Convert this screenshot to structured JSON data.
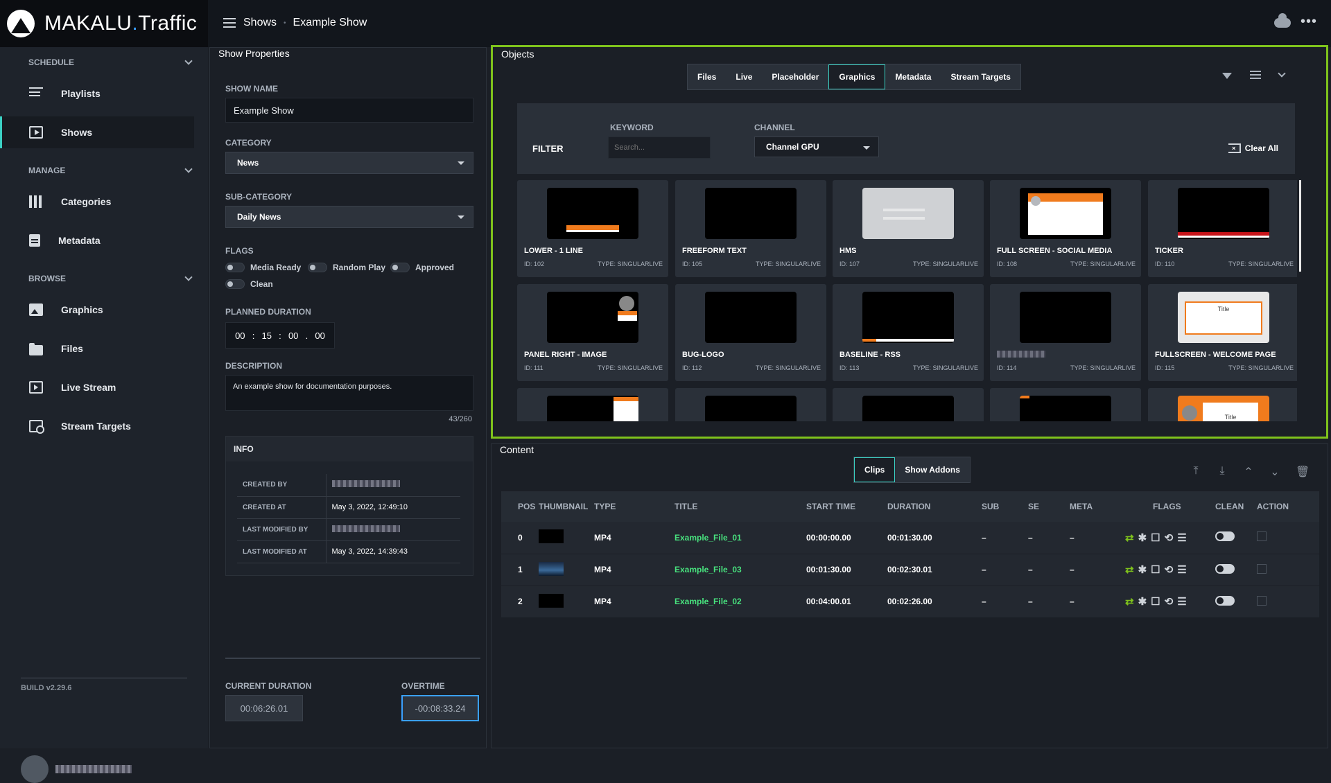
{
  "app": {
    "brand_main": "MAKALU",
    "brand_dot": ".",
    "brand_sub": "Traffic"
  },
  "breadcrumb": {
    "root": "Shows",
    "sep": "•",
    "current": "Example Show"
  },
  "sidebar": {
    "sections": [
      {
        "label": "SCHEDULE",
        "items": [
          {
            "label": "Playlists",
            "icon": "playlist-icon"
          },
          {
            "label": "Shows",
            "icon": "play-icon",
            "active": true
          }
        ]
      },
      {
        "label": "MANAGE",
        "items": [
          {
            "label": "Categories",
            "icon": "categories-icon"
          },
          {
            "label": "Metadata",
            "icon": "document-icon"
          }
        ]
      },
      {
        "label": "BROWSE",
        "items": [
          {
            "label": "Graphics",
            "icon": "image-icon"
          },
          {
            "label": "Files",
            "icon": "folder-icon"
          },
          {
            "label": "Live Stream",
            "icon": "live-icon"
          },
          {
            "label": "Stream Targets",
            "icon": "target-icon"
          }
        ]
      }
    ],
    "build": "BUILD v2.29.6"
  },
  "props": {
    "title": "Show Properties",
    "show_name_label": "SHOW NAME",
    "show_name": "Example Show",
    "category_label": "CATEGORY",
    "category": "News",
    "subcategory_label": "SUB-CATEGORY",
    "subcategory": "Daily News",
    "flags_label": "FLAGS",
    "flags": [
      "Media Ready",
      "Random Play",
      "Approved",
      "Clean"
    ],
    "planned_label": "PLANNED DURATION",
    "planned": [
      "00",
      "15",
      "00",
      "00"
    ],
    "description_label": "DESCRIPTION",
    "description": "An example show for documentation purposes.",
    "char_count": "43/260",
    "info_title": "INFO",
    "info": [
      {
        "key": "CREATED BY",
        "value": ""
      },
      {
        "key": "CREATED AT",
        "value": "May 3, 2022, 12:49:10"
      },
      {
        "key": "LAST MODIFIED BY",
        "value": ""
      },
      {
        "key": "LAST MODIFIED AT",
        "value": "May 3, 2022, 14:39:43"
      }
    ],
    "current_label": "CURRENT DURATION",
    "current": "00:06:26.01",
    "overtime_label": "OVERTIME",
    "overtime": "-00:08:33.24"
  },
  "objects": {
    "title": "Objects",
    "tabs": [
      "Files",
      "Live",
      "Placeholder",
      "Graphics",
      "Metadata",
      "Stream Targets"
    ],
    "active_tab": "Graphics",
    "filter_label": "FILTER",
    "keyword_label": "KEYWORD",
    "keyword_placeholder": "Search...",
    "channel_label": "CHANNEL",
    "channel": "Channel GPU",
    "clear_all": "Clear All",
    "cards": [
      {
        "name": "LOWER - 1 LINE",
        "id": "ID: 102",
        "type": "TYPE: SINGULARLIVE"
      },
      {
        "name": "FREEFORM TEXT",
        "id": "ID: 105",
        "type": "TYPE: SINGULARLIVE"
      },
      {
        "name": "HMS",
        "id": "ID: 107",
        "type": "TYPE: SINGULARLIVE"
      },
      {
        "name": "FULL SCREEN - SOCIAL MEDIA",
        "id": "ID: 108",
        "type": "TYPE: SINGULARLIVE"
      },
      {
        "name": "TICKER",
        "id": "ID: 110",
        "type": "TYPE: SINGULARLIVE"
      },
      {
        "name": "PANEL RIGHT - IMAGE",
        "id": "ID: 111",
        "type": "TYPE: SINGULARLIVE"
      },
      {
        "name": "BUG-LOGO",
        "id": "ID: 112",
        "type": "TYPE: SINGULARLIVE"
      },
      {
        "name": "BASELINE - RSS",
        "id": "ID: 113",
        "type": "TYPE: SINGULARLIVE"
      },
      {
        "name": "",
        "id": "ID: 114",
        "type": "TYPE: SINGULARLIVE"
      },
      {
        "name": "FULLSCREEN - WELCOME PAGE",
        "id": "ID: 115",
        "type": "TYPE: SINGULARLIVE"
      }
    ],
    "thumb_title_text": "Title"
  },
  "content": {
    "title": "Content",
    "tabs": [
      "Clips",
      "Show Addons"
    ],
    "columns": [
      "POS",
      "THUMBNAIL",
      "TYPE",
      "TITLE",
      "START TIME",
      "DURATION",
      "SUB",
      "SE",
      "META",
      "FLAGS",
      "CLEAN",
      "ACTION"
    ],
    "rows": [
      {
        "pos": "0",
        "type": "MP4",
        "title": "Example_File_01",
        "start": "00:00:00.00",
        "duration": "00:01:30.00",
        "sub": "–",
        "se": "–",
        "meta": "–"
      },
      {
        "pos": "1",
        "type": "MP4",
        "title": "Example_File_03",
        "start": "00:01:30.00",
        "duration": "00:02:30.01",
        "sub": "–",
        "se": "–",
        "meta": "–"
      },
      {
        "pos": "2",
        "type": "MP4",
        "title": "Example_File_02",
        "start": "00:04:00.01",
        "duration": "00:02:26.00",
        "sub": "–",
        "se": "–",
        "meta": "–"
      }
    ]
  }
}
